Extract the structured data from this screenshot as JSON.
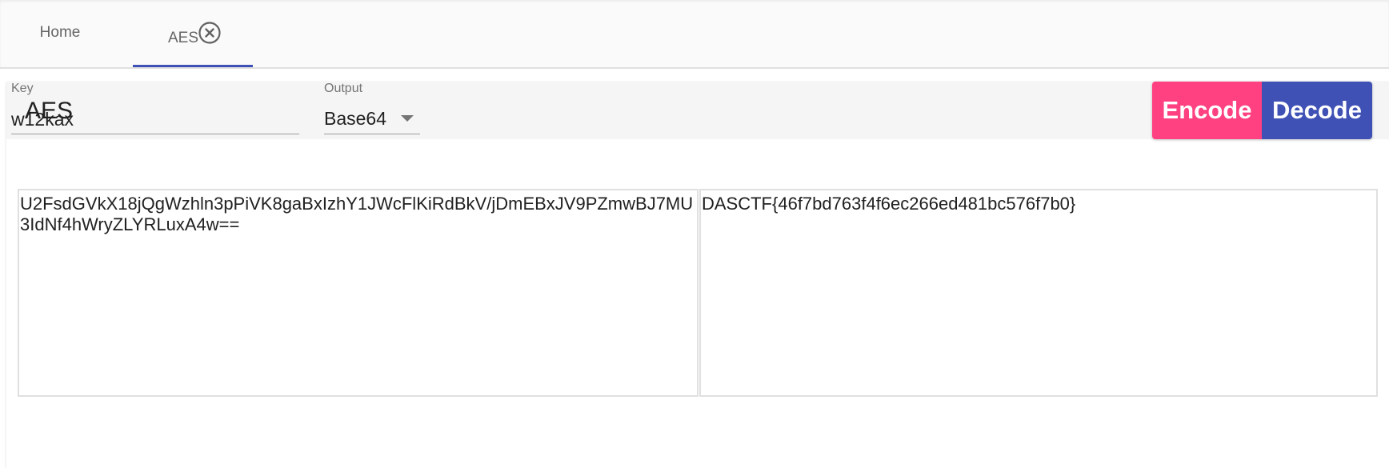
{
  "tabs": {
    "home_label": "Home",
    "aes_label": "AES"
  },
  "card": {
    "title": "AES",
    "encode_label": "Encode",
    "decode_label": "Decode"
  },
  "form": {
    "key_label": "Key",
    "key_value": "w12kax",
    "output_label": "Output",
    "output_value": "Base64"
  },
  "io": {
    "input_text": "U2FsdGVkX18jQgWzhln3pPiVK8gaBxIzhY1JWcFlKiRdBkV/jDmEBxJV9PZmwBJ7MU3IdNf4hWryZLYRLuxA4w==",
    "output_text": "DASCTF{46f7bd763f4f6ec266ed481bc576f7b0}"
  },
  "colors": {
    "accent": "#3f51b5",
    "encode": "#ff4081",
    "decode": "#3f51b5"
  },
  "icons": {
    "tab_close": "close-circle-icon",
    "dropdown": "arrow-drop-down-icon"
  }
}
